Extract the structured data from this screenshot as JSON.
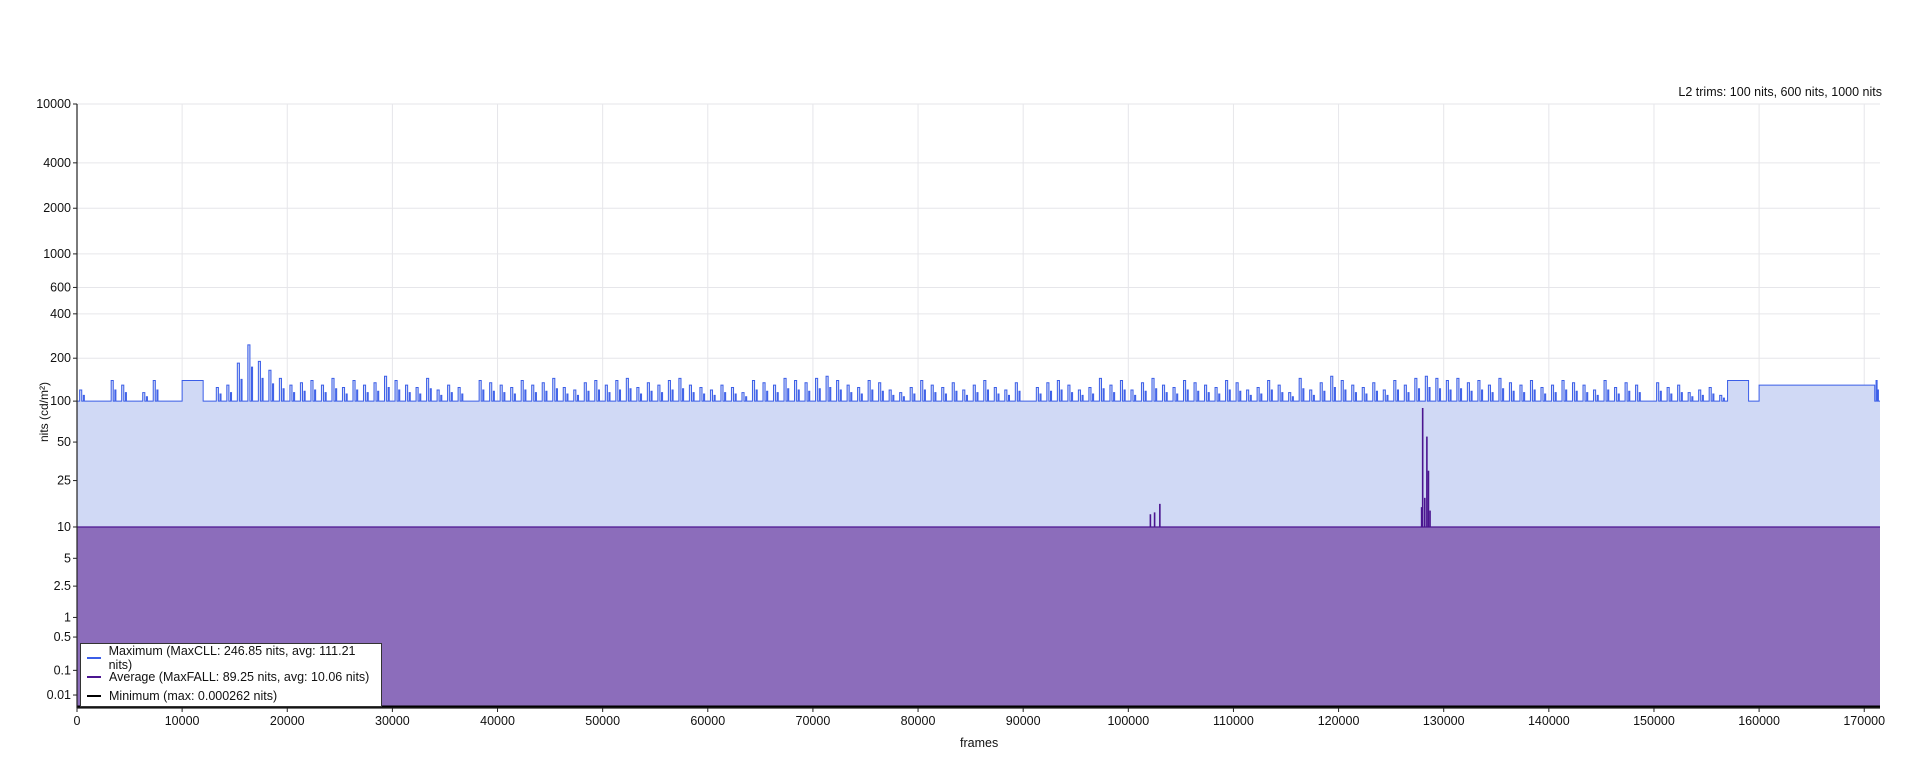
{
  "chart_data": {
    "type": "area",
    "top_right_text": "L2 trims: 100 nits, 600 nits, 1000 nits",
    "xlabel": "frames",
    "ylabel": "nits (cd/m²)",
    "y_scale": "PQ (SMPTE ST 2084)",
    "xlim": [
      0,
      171500
    ],
    "ylim": [
      0,
      10000
    ],
    "grid": true,
    "legend_position": "bottom-left",
    "x_ticks": [
      "0",
      "10000",
      "20000",
      "30000",
      "40000",
      "50000",
      "60000",
      "70000",
      "80000",
      "90000",
      "100000",
      "110000",
      "120000",
      "130000",
      "140000",
      "150000",
      "160000",
      "170000"
    ],
    "y_ticks": [
      "10000",
      "4000",
      "2000",
      "1000",
      "600",
      "400",
      "200",
      "100",
      "50",
      "25",
      "10",
      "5",
      "2.5",
      "1",
      "0.5",
      "0.1",
      "0.01"
    ],
    "series": [
      {
        "name": "Maximum (MaxCLL: 246.85 nits, avg: 111.21 nits)",
        "color": "#3b5ee8",
        "fill": "#d0d9f5",
        "baseline": 100,
        "x_step": 1000,
        "values": [
          120,
          100,
          100,
          140,
          130,
          100,
          115,
          140,
          100,
          100,
          140,
          140,
          100,
          125,
          130,
          185,
          247,
          190,
          165,
          145,
          130,
          135,
          140,
          130,
          145,
          125,
          140,
          130,
          135,
          150,
          140,
          130,
          125,
          145,
          120,
          130,
          125,
          100,
          140,
          135,
          130,
          125,
          140,
          130,
          135,
          145,
          125,
          120,
          135,
          140,
          130,
          140,
          145,
          125,
          135,
          130,
          140,
          145,
          130,
          125,
          120,
          130,
          125,
          115,
          140,
          135,
          130,
          145,
          140,
          135,
          145,
          150,
          140,
          130,
          125,
          140,
          135,
          120,
          115,
          125,
          140,
          130,
          125,
          135,
          120,
          130,
          140,
          125,
          120,
          135,
          100,
          125,
          135,
          140,
          130,
          120,
          125,
          145,
          130,
          140,
          120,
          135,
          145,
          130,
          125,
          140,
          135,
          130,
          125,
          140,
          135,
          120,
          125,
          140,
          130,
          115,
          145,
          120,
          135,
          150,
          140,
          130,
          125,
          135,
          120,
          140,
          130,
          145,
          150,
          145,
          140,
          145,
          135,
          140,
          130,
          145,
          135,
          130,
          140,
          125,
          130,
          140,
          135,
          130,
          120,
          140,
          125,
          135,
          130,
          100,
          135,
          125,
          130,
          115,
          120,
          125,
          110,
          140,
          140,
          100,
          130,
          130,
          130,
          130,
          130,
          130,
          130,
          130,
          130,
          130,
          130,
          140
        ]
      },
      {
        "name": "Average (MaxFALL: 89.25 nits, avg: 10.06 nits)",
        "color": "#4b1590",
        "fill": "#8c6dbb",
        "baseline": 10,
        "spikes": [
          [
            102100,
            13
          ],
          [
            102500,
            13.5
          ],
          [
            103000,
            16
          ],
          [
            127900,
            15
          ],
          [
            128000,
            89.25
          ],
          [
            128200,
            18
          ],
          [
            128400,
            55
          ],
          [
            128550,
            30
          ],
          [
            128700,
            14
          ]
        ]
      },
      {
        "name": "Minimum (max: 0.000262 nits)",
        "color": "#000000",
        "max": 0.000262
      }
    ]
  }
}
